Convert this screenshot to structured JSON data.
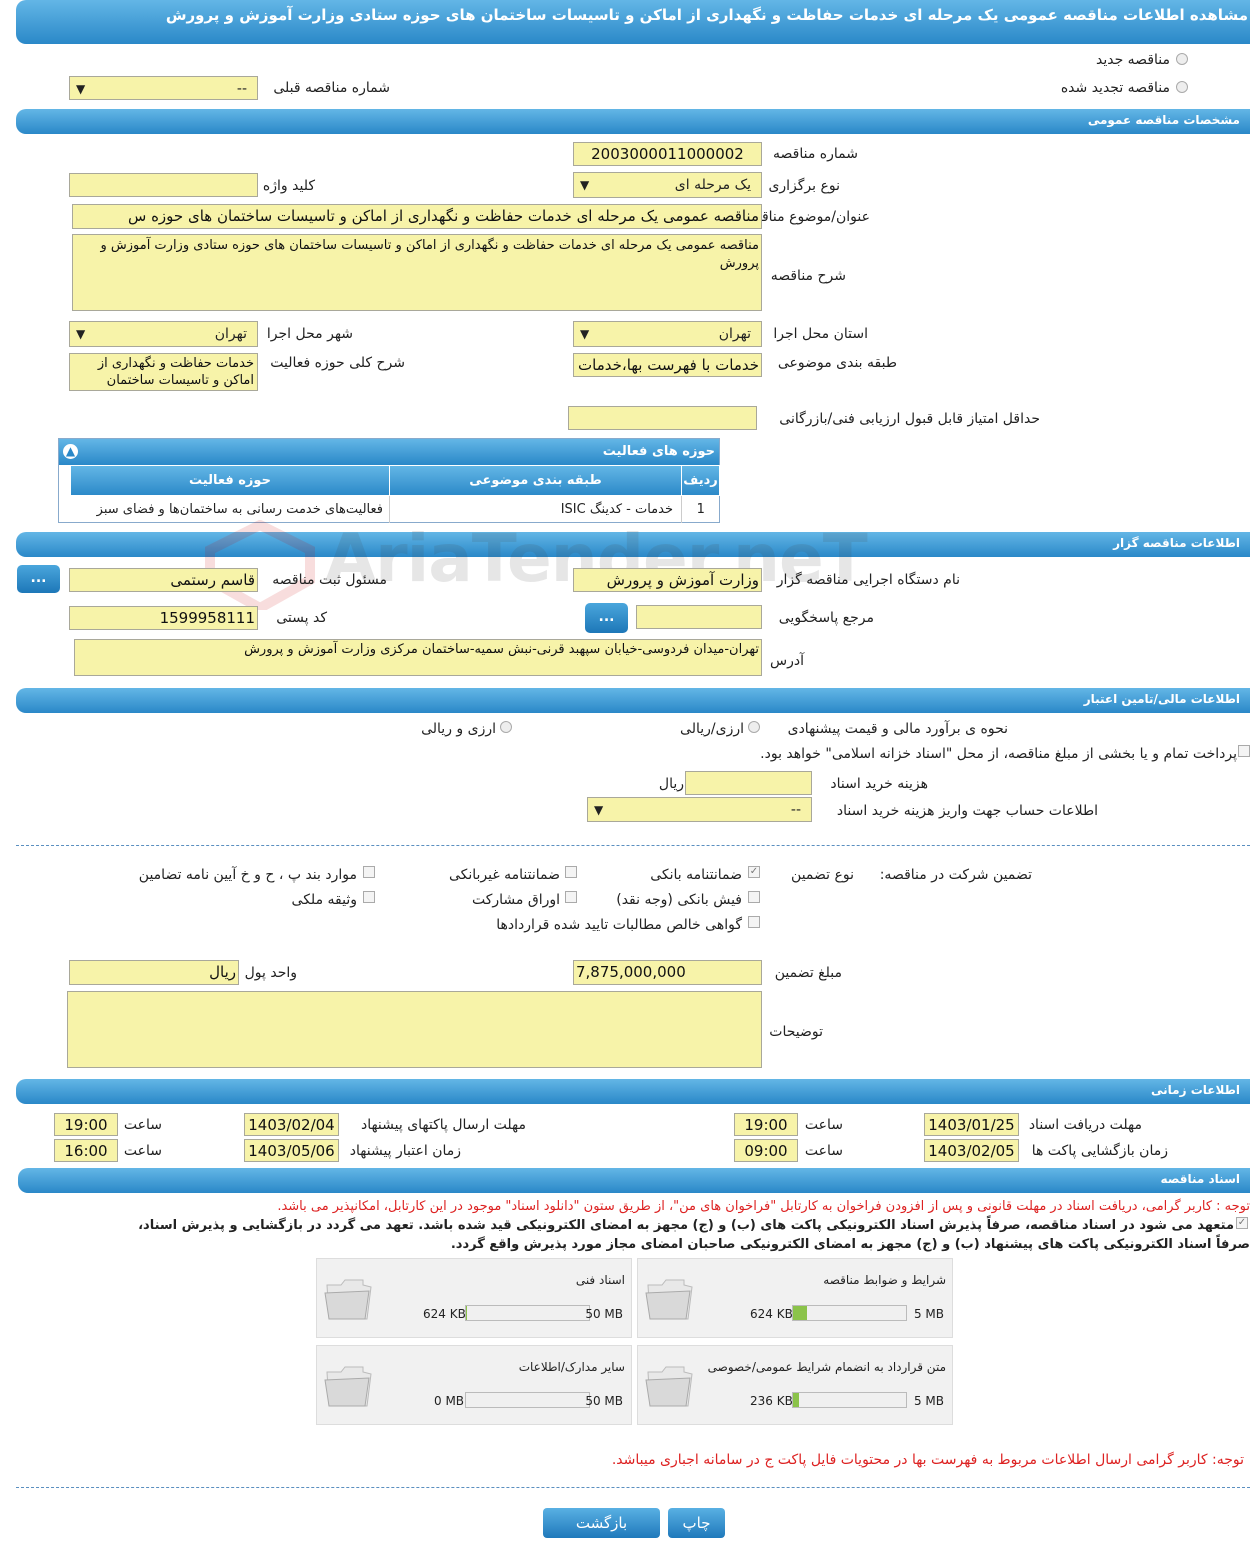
{
  "page": {
    "title": "مشاهده اطلاعات مناقصه عمومی یک مرحله ای خدمات حفاظت و نگهداری از اماکن و تاسیسات ساختمان های حوزه ستادی وزارت آموزش و پرورش"
  },
  "tender_type": {
    "new_label": "مناقصه جدید",
    "renewed_label": "مناقصه تجدید شده",
    "prev_number_label": "شماره مناقصه قبلی",
    "prev_number_value": "--"
  },
  "general": {
    "section_title": "مشخصات مناقصه عمومی",
    "number_label": "شماره مناقصه",
    "number_value": "2003000011000002",
    "type_label": "نوع برگزاری",
    "type_value": "یک مرحله ای",
    "keyword_label": "کلید واژه",
    "keyword_value": "",
    "subject_label": "عنوان/موضوع مناقصه",
    "subject_value": "مناقصه عمومی یک مرحله ای خدمات حفاظت و نگهداری از اماکن و تاسیسات ساختمان های حوزه س",
    "desc_label": "شرح مناقصه",
    "desc_value": "مناقصه عمومی یک مرحله ای خدمات حفاظت و نگهداری از اماکن و تاسیسات ساختمان های حوزه ستادی وزارت آموزش و پرورش",
    "province_label": "استان محل اجرا",
    "province_value": "تهران",
    "city_label": "شهر محل اجرا",
    "city_value": "تهران",
    "category_label": "طبقه بندی موضوعی",
    "category_value": "خدمات با فهرست بها،خدمات",
    "activity_desc_label": "شرح کلی حوزه فعالیت",
    "activity_desc_value": "خدمات حفاظت و نگهداری از اماکن و تاسیسات ساختمان",
    "min_score_label": "حداقل امتیاز قابل قبول ارزیابی فنی/بازرگانی",
    "min_score_value": ""
  },
  "activities": {
    "title": "حوزه های فعالیت",
    "headers": [
      "ردیف",
      "طبقه بندی موضوعی",
      "حوزه فعالیت"
    ],
    "rows": [
      {
        "n": "1",
        "cat": "خدمات - کدینگ ISIC",
        "area": "فعالیت‌های خدمت رسانی به ساختمان‌ها و فضای سبز"
      }
    ]
  },
  "watermark": "AriaTender.neT",
  "organizer": {
    "section_title": "اطلاعات مناقصه گزار",
    "org_label": "نام دستگاه اجرایی مناقصه گزار",
    "org_value": "وزارت آموزش و پرورش",
    "resp_label": "مسئول ثبت مناقصه",
    "resp_value": "قاسم رستمی",
    "ref_label": "مرجع پاسخگویی",
    "ref_value": "",
    "postal_label": "کد پستی",
    "postal_value": "1599958111",
    "address_label": "آدرس",
    "address_value": "تهران-میدان فردوسی-خیابان سپهبد قرنی-نبش سمیه-ساختمان مرکزی وزارت آموزش و پرورش",
    "dots": "..."
  },
  "finance": {
    "section_title": "اطلاعات مالی/تامین اعتبار",
    "method_label": "نحوه ی برآورد مالی و قیمت پیشنهادی",
    "opt_rial": "ارزی/ریالی",
    "opt_fx": "ارزی و ریالی",
    "treasury_label": "پرداخت تمام و یا بخشی از مبلغ مناقصه، از محل \"اسناد خزانه اسلامی\" خواهد بود.",
    "doc_cost_label": "هزینه خرید اسناد",
    "doc_cost_value": "",
    "doc_cost_unit": "ریال",
    "account_label": "اطلاعات حساب جهت واریز هزینه خرید اسناد",
    "account_value": "--"
  },
  "guarantee": {
    "main_label": "تضمین شرکت در مناقصه:",
    "type_label": "نوع تضمین",
    "bank": "ضمانتنامه بانکی",
    "nonbank": "ضمانتنامه غیربانکی",
    "items": "موارد بند پ ، ح و خ آیین نامه تضامین",
    "cash": "فیش بانکی (وجه نقد)",
    "bonds": "اوراق مشارکت",
    "property": "وثیقه ملکی",
    "claims": "گواهی خالص مطالبات تایید شده قراردادها",
    "amount_label": "مبلغ تضمین",
    "amount_value": "7,875,000,000",
    "currency_label": "واحد پول",
    "currency_value": "ریال",
    "notes_label": "توضیحات",
    "notes_value": ""
  },
  "timing": {
    "section_title": "اطلاعات زمانی",
    "doc_recv_label": "مهلت دریافت اسناد",
    "doc_recv_date": "1403/01/25",
    "doc_recv_time": "19:00",
    "send_label": "مهلت ارسال پاکتهای پیشنهاد",
    "send_date": "1403/02/04",
    "send_time": "19:00",
    "open_label": "زمان بازگشایی پاکت ها",
    "open_date": "1403/02/05",
    "open_time": "09:00",
    "validity_label": "زمان اعتبار پیشنهاد",
    "validity_date": "1403/05/06",
    "validity_time": "16:00",
    "time_label": "ساعت"
  },
  "docs": {
    "section_title": "اسناد مناقصه",
    "note1": "توجه : کاربر گرامی، دریافت اسناد در مهلت قانونی و پس از افزودن فراخوان به کارتابل \"فراخوان های من\"، از طریق ستون \"دانلود اسناد\" موجود در این کارتابل، امکانپذیر می باشد.",
    "commit1": "متعهد می شود در اسناد مناقصه، صرفاً پذیرش اسناد الکترونیکی پاکت های (ب) و (ج) مجهز به امضای الکترونیکی قید شده باشد. تعهد می گردد در بازگشایی و پذیرش اسناد،",
    "commit2": "صرفاً اسناد الکترونیکی پاکت های پیشنهاد (ب) و (ج) مجهز به امضای الکترونیکی صاحبان امضای مجاز مورد پذیرش واقع گردد.",
    "files": [
      {
        "name": "شرایط و ضوابط مناقصه",
        "size": "624 KB",
        "max": "5 MB",
        "fill": 0.12
      },
      {
        "name": "اسناد فنی",
        "size": "624 KB",
        "max": "50 MB",
        "fill": 0.012
      },
      {
        "name": "متن قرارداد به انضمام شرایط عمومی/خصوصی",
        "size": "236 KB",
        "max": "5 MB",
        "fill": 0.05
      },
      {
        "name": "سایر مدارک/اطلاعات",
        "size": "0 MB",
        "max": "50 MB",
        "fill": 0.0
      }
    ],
    "note2": "توجه: کاربر گرامی ارسال اطلاعات مربوط به فهرست بها در محتویات فایل پاکت ج در سامانه اجباری میباشد."
  },
  "actions": {
    "print": "چاپ",
    "back": "بازگشت"
  }
}
